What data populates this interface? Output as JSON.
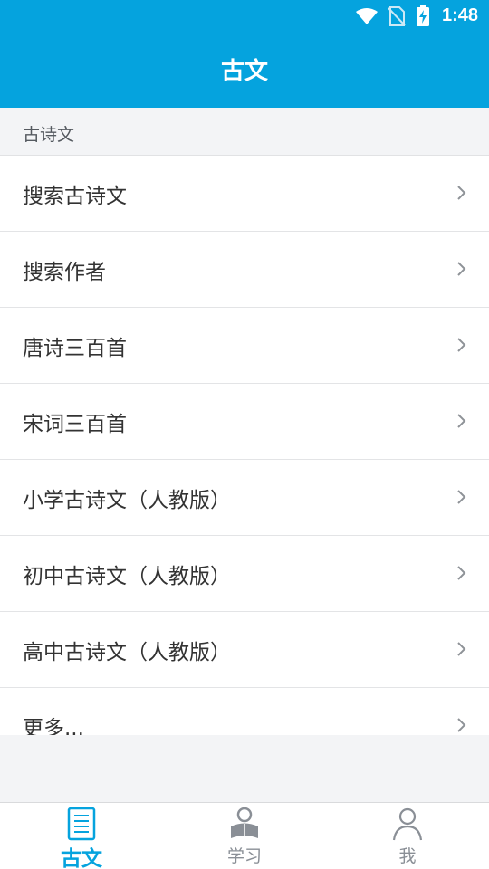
{
  "status_bar": {
    "time": "1:48"
  },
  "header": {
    "title": "古文"
  },
  "section": {
    "label": "古诗文"
  },
  "list": {
    "items": [
      {
        "label": "搜索古诗文"
      },
      {
        "label": "搜索作者"
      },
      {
        "label": "唐诗三百首"
      },
      {
        "label": "宋词三百首"
      },
      {
        "label": "小学古诗文（人教版）"
      },
      {
        "label": "初中古诗文（人教版）"
      },
      {
        "label": "高中古诗文（人教版）"
      },
      {
        "label": "更多..."
      }
    ]
  },
  "tabs": [
    {
      "label": "古文",
      "icon": "document-icon",
      "active": true
    },
    {
      "label": "学习",
      "icon": "reader-icon",
      "active": false
    },
    {
      "label": "我",
      "icon": "person-icon",
      "active": false
    }
  ],
  "colors": {
    "accent": "#05a3de",
    "text": "#333333",
    "muted": "#8a8f96",
    "background": "#f3f4f6"
  }
}
